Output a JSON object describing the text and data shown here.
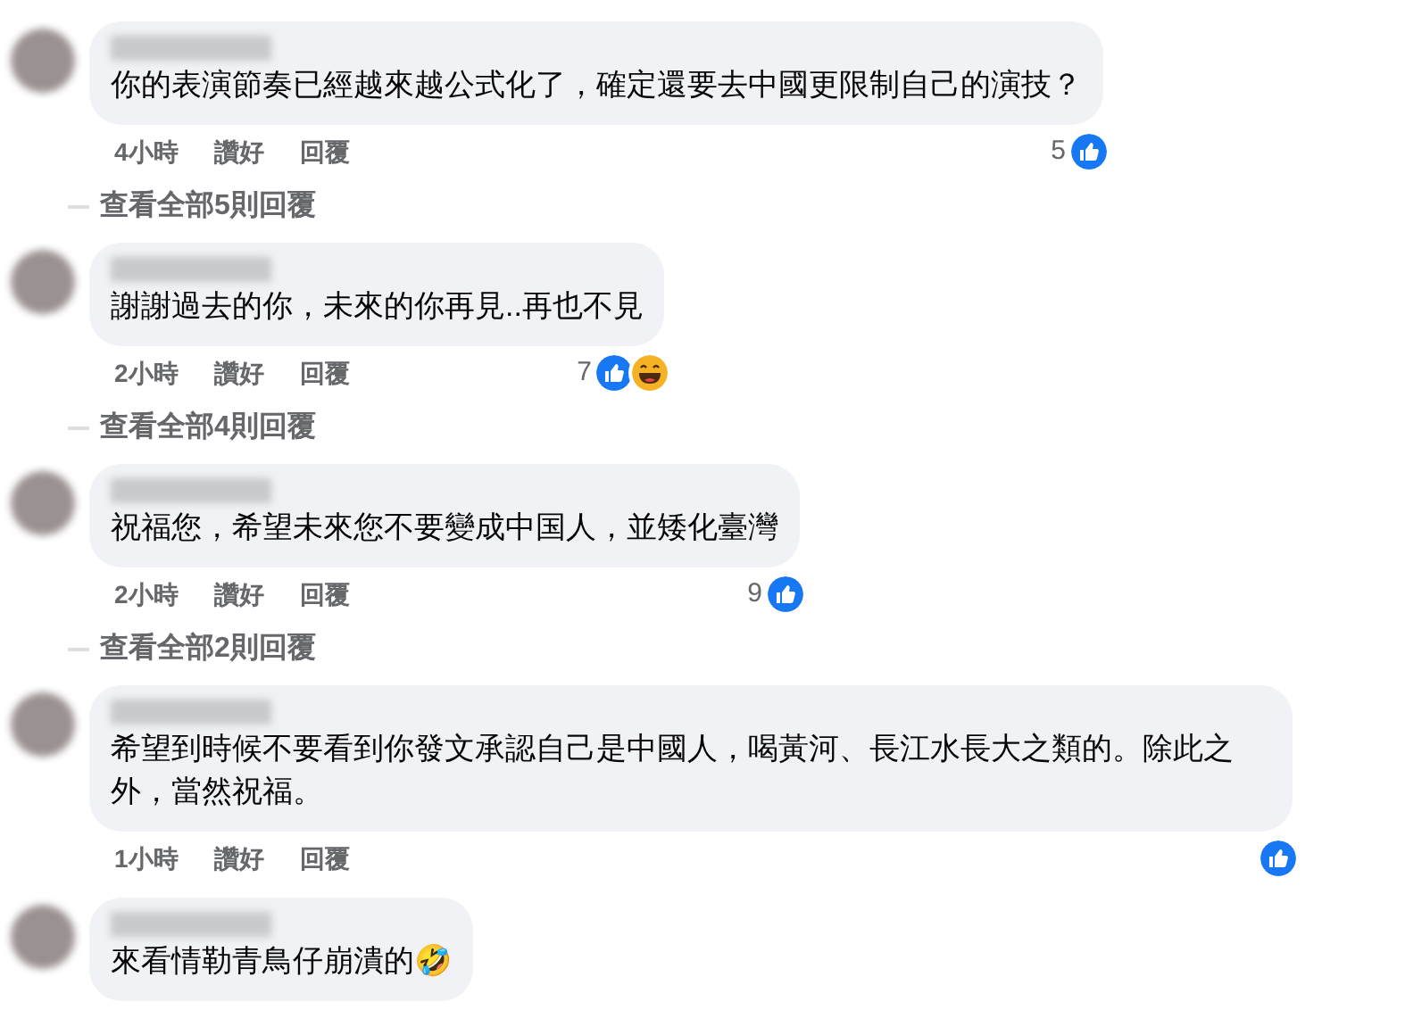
{
  "comments": [
    {
      "text": "你的表演節奏已經越來越公式化了，確定還要去中國更限制自己的演技？",
      "time": "4小時",
      "like": "讚好",
      "reply": "回覆",
      "reaction_count": "5",
      "reactions": [
        {
          "kind": "like"
        }
      ],
      "view_replies": "查看全部5則回覆"
    },
    {
      "text": "謝謝過去的你，未來的你再見..再也不見",
      "time": "2小時",
      "like": "讚好",
      "reply": "回覆",
      "reaction_count": "7",
      "reactions": [
        {
          "kind": "like"
        },
        {
          "kind": "haha"
        }
      ],
      "view_replies": "查看全部4則回覆"
    },
    {
      "text": "祝福您，希望未來您不要變成中国人，並矮化臺灣",
      "time": "2小時",
      "like": "讚好",
      "reply": "回覆",
      "reaction_count": "9",
      "reactions": [
        {
          "kind": "like"
        }
      ],
      "view_replies": "查看全部2則回覆"
    },
    {
      "text": "希望到時候不要看到你發文承認自己是中國人，喝黃河、長江水長大之類的。除此之外，當然祝福。",
      "time": "1小時",
      "like": "讚好",
      "reply": "回覆",
      "reactions": [
        {
          "kind": "like"
        }
      ]
    },
    {
      "text": "來看情勒青鳥仔崩潰的🤣"
    }
  ]
}
